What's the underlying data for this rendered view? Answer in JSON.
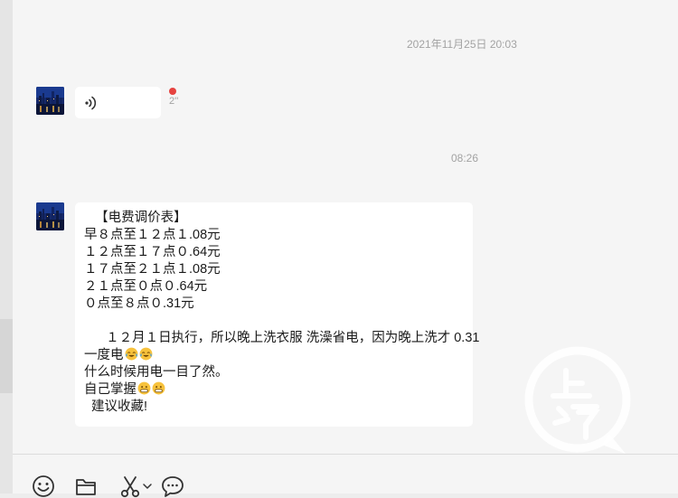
{
  "chat": {
    "timestamp_1": "2021年11月25日 20:03",
    "timestamp_2": "08:26",
    "voice_message": {
      "duration": "2''",
      "unread": true,
      "icon": "voice-wave-icon"
    },
    "text_message": {
      "lines": [
        "   【电费调价表】",
        "早８点至１２点１.08元",
        "１２点至１７点０.64元",
        "１７点至２１点１.08元",
        "２１点至０点０.64元",
        "０点至８点０.31元",
        "",
        "      １２月１日执行，所以晚上洗衣服 洗澡省电，因为晚上洗才 0.31",
        "一度电",
        "什么时候用电一目了然。",
        "自己掌握",
        "  建议收藏!"
      ],
      "emoji_after_line_8": [
        "laughing-crying-emoji",
        "laughing-crying-emoji"
      ],
      "emoji_after_line_10": [
        "grinning-emoji",
        "grinning-emoji"
      ]
    }
  },
  "watermark": {
    "text": "上游"
  },
  "toolbar": {
    "icons": [
      "smiley-icon",
      "folder-icon",
      "scissors-icon",
      "chevron-down-icon",
      "chat-bubble-icon"
    ]
  },
  "colors": {
    "chat_background": "#f5f5f5",
    "bubble": "#ffffff",
    "unread_dot": "#e64340",
    "timestamp_text": "#a3a3a3"
  }
}
